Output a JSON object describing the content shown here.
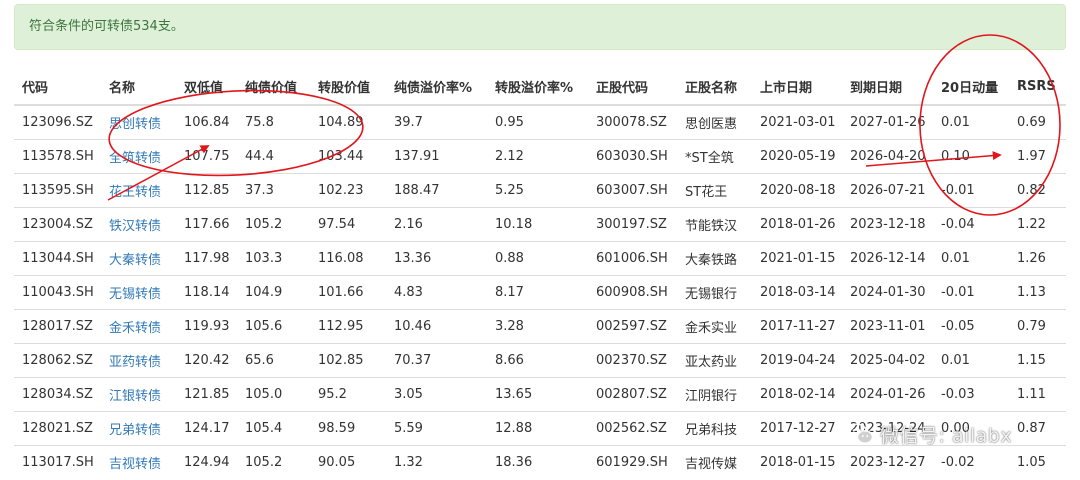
{
  "summary": "符合条件的可转债534支。",
  "columns": [
    "代码",
    "名称",
    "双低值",
    "纯债价值",
    "转股价值",
    "纯债溢价率%",
    "转股溢价率%",
    "正股代码",
    "正股名称",
    "上市日期",
    "到期日期",
    "20日动量",
    "RSRS"
  ],
  "rows": [
    [
      "123096.SZ",
      "思创转债",
      "106.84",
      "75.8",
      "104.89",
      "39.7",
      "0.95",
      "300078.SZ",
      "思创医惠",
      "2021-03-01",
      "2027-01-26",
      "0.01",
      "0.69"
    ],
    [
      "113578.SH",
      "全筑转债",
      "107.75",
      "44.4",
      "103.44",
      "137.91",
      "2.12",
      "603030.SH",
      "*ST全筑",
      "2020-05-19",
      "2026-04-20",
      "0.10",
      "1.97"
    ],
    [
      "113595.SH",
      "花王转债",
      "112.85",
      "37.3",
      "102.23",
      "188.47",
      "5.25",
      "603007.SH",
      "ST花王",
      "2020-08-18",
      "2026-07-21",
      "-0.01",
      "0.82"
    ],
    [
      "123004.SZ",
      "铁汉转债",
      "117.66",
      "105.2",
      "97.54",
      "2.16",
      "10.18",
      "300197.SZ",
      "节能铁汉",
      "2018-01-26",
      "2023-12-18",
      "-0.04",
      "1.22"
    ],
    [
      "113044.SH",
      "大秦转债",
      "117.98",
      "103.3",
      "116.08",
      "13.36",
      "0.88",
      "601006.SH",
      "大秦铁路",
      "2021-01-15",
      "2026-12-14",
      "0.01",
      "1.26"
    ],
    [
      "110043.SH",
      "无锡转债",
      "118.14",
      "104.9",
      "101.66",
      "4.83",
      "8.17",
      "600908.SH",
      "无锡银行",
      "2018-03-14",
      "2024-01-30",
      "-0.01",
      "1.13"
    ],
    [
      "128017.SZ",
      "金禾转债",
      "119.93",
      "105.6",
      "112.95",
      "10.46",
      "3.28",
      "002597.SZ",
      "金禾实业",
      "2017-11-27",
      "2023-11-01",
      "-0.05",
      "0.79"
    ],
    [
      "128062.SZ",
      "亚药转债",
      "120.42",
      "65.6",
      "102.85",
      "70.37",
      "8.66",
      "002370.SZ",
      "亚太药业",
      "2019-04-24",
      "2025-04-02",
      "0.01",
      "1.15"
    ],
    [
      "128034.SZ",
      "江银转债",
      "121.85",
      "105.0",
      "95.2",
      "3.05",
      "13.65",
      "002807.SZ",
      "江阴银行",
      "2018-02-14",
      "2024-01-26",
      "-0.03",
      "1.11"
    ],
    [
      "128021.SZ",
      "兄弟转债",
      "124.17",
      "105.4",
      "98.59",
      "5.59",
      "12.88",
      "002562.SZ",
      "兄弟科技",
      "2017-12-27",
      "2023-12-24",
      "0.00",
      "0.87"
    ],
    [
      "113017.SH",
      "吉视转债",
      "124.94",
      "105.2",
      "90.05",
      "1.32",
      "18.36",
      "601929.SH",
      "吉视传媒",
      "2018-01-15",
      "2023-12-27",
      "-0.02",
      "1.05"
    ]
  ],
  "watermark": "微信号: ailabx",
  "colors": {
    "alert_bg": "#dff0d8",
    "alert_text": "#3c763d",
    "link": "#337ab7",
    "annotation": "#e0161b"
  },
  "icons": {
    "watermark": "wechat-icon"
  }
}
